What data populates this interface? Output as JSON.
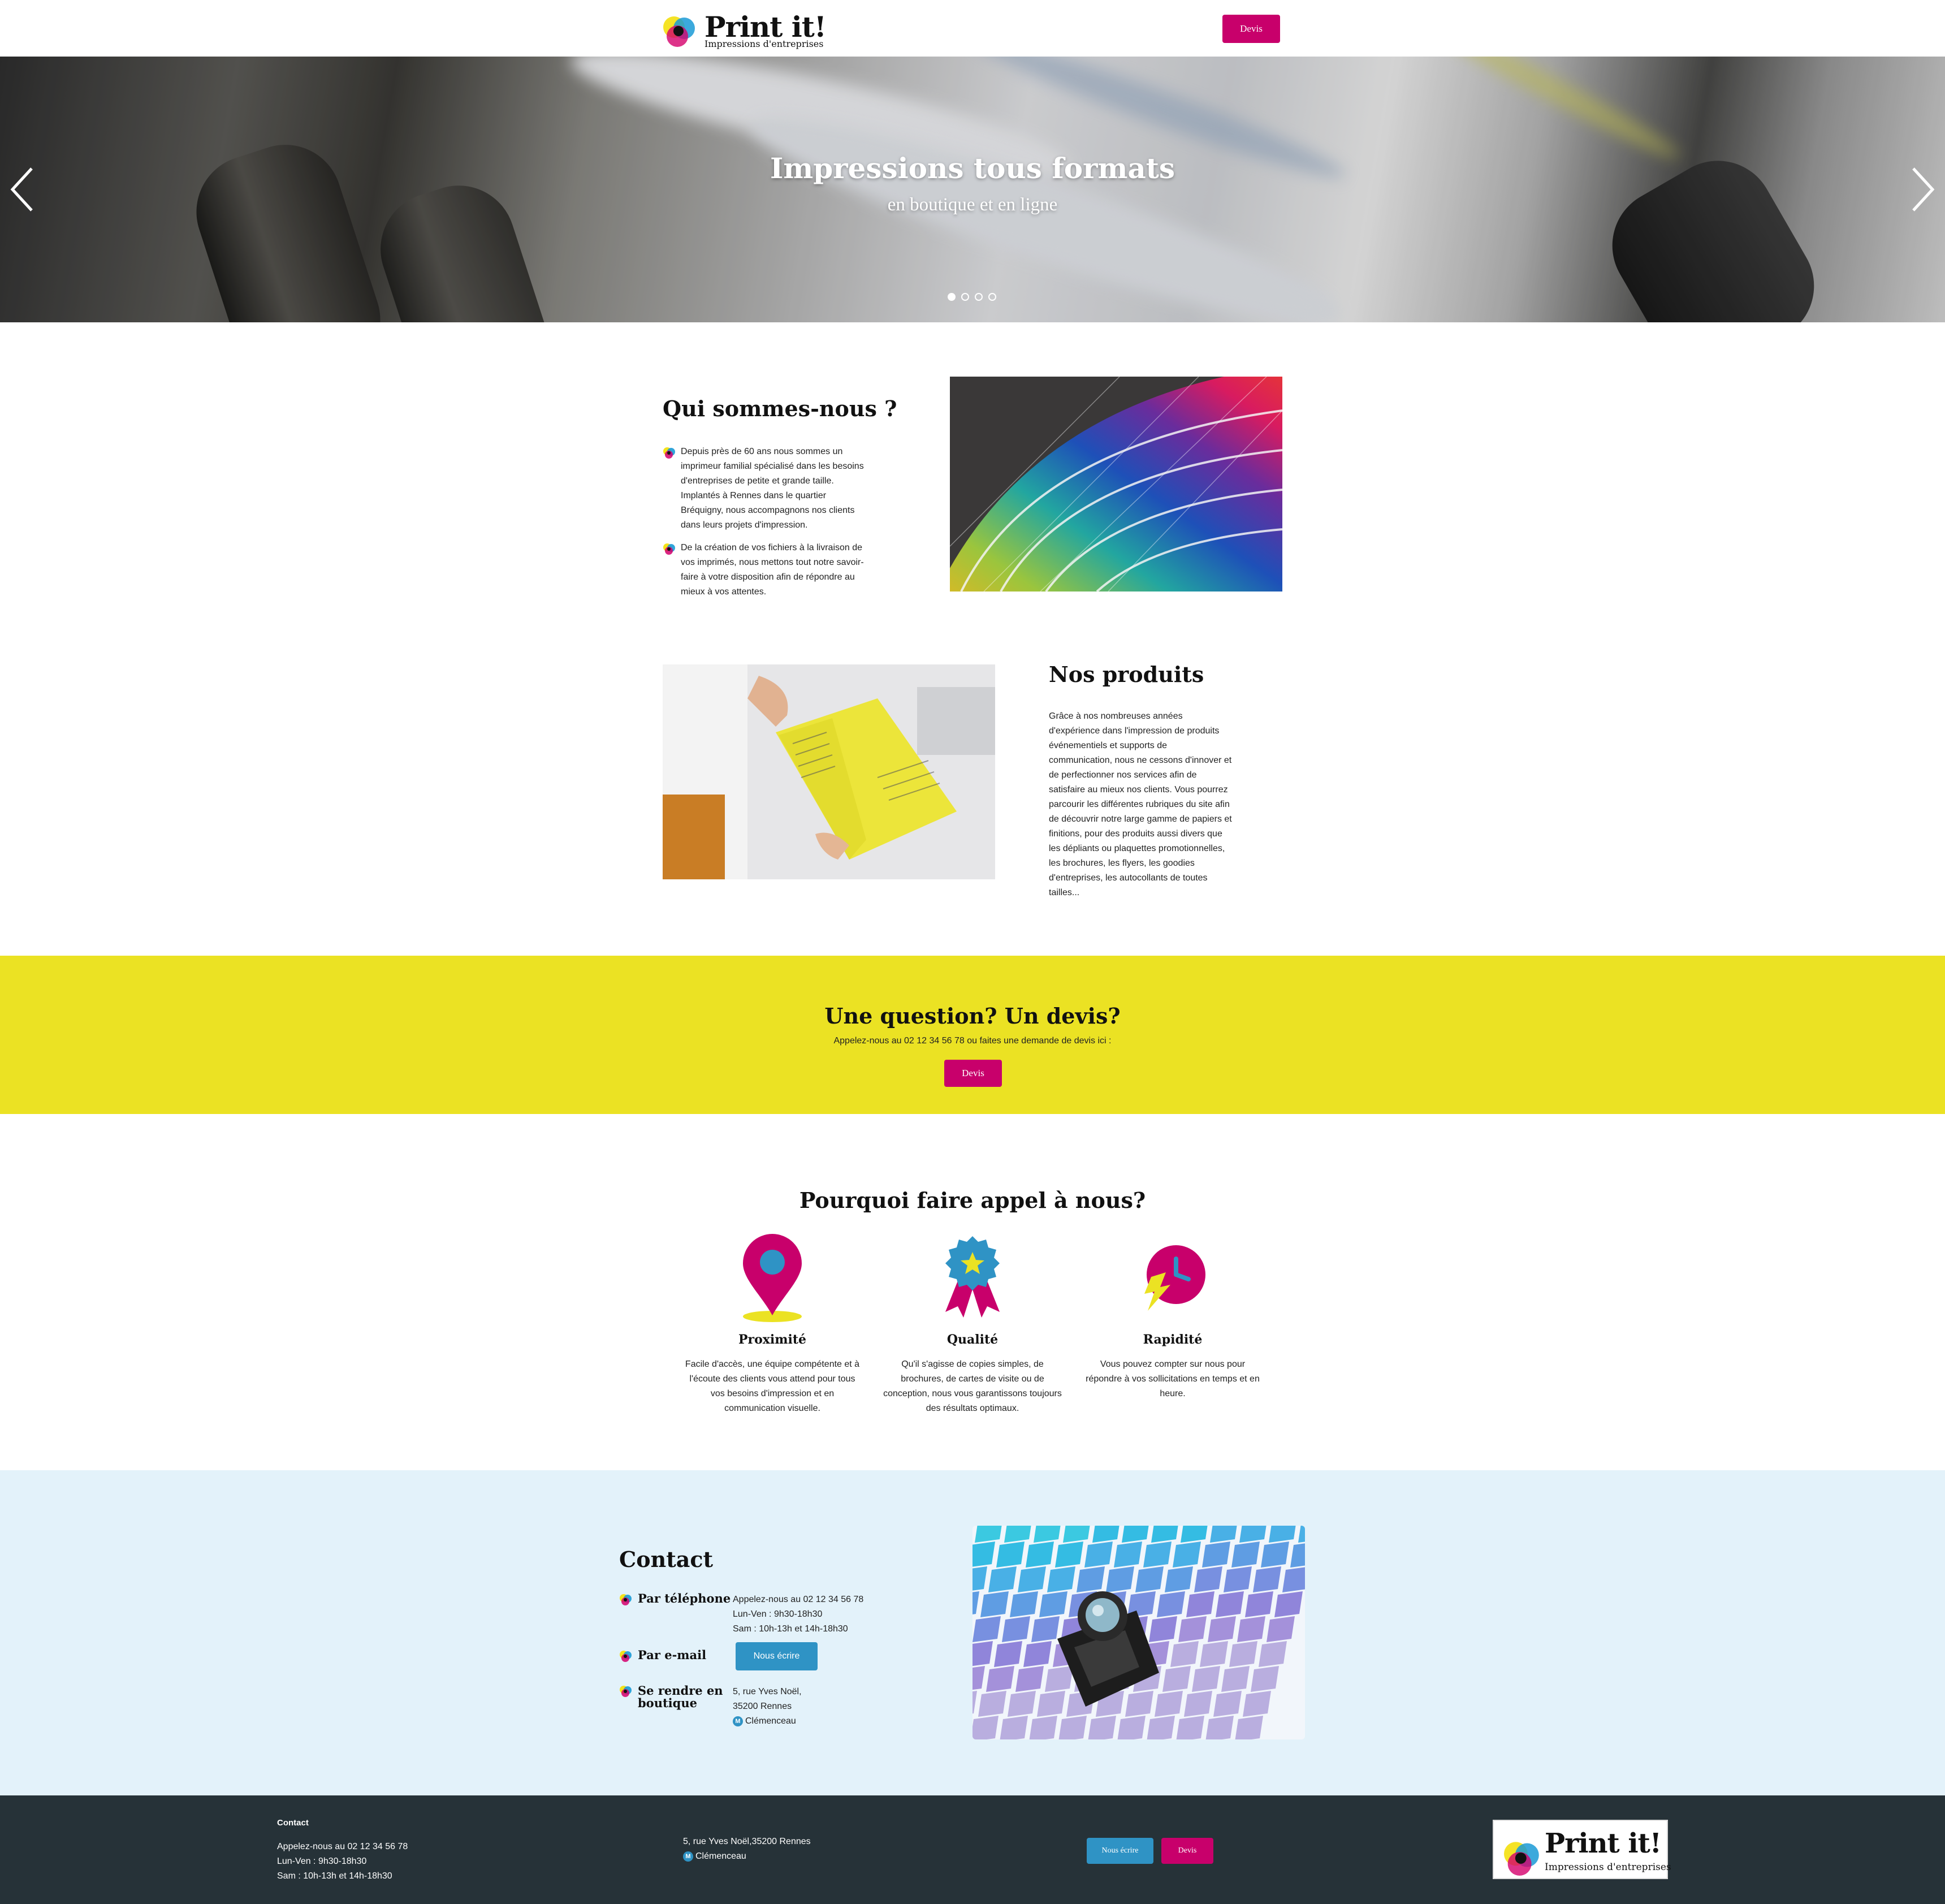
{
  "header": {
    "logo_title": "Print it!",
    "logo_subtitle": "Impressions d'entreprises",
    "quote_button": "Devis"
  },
  "hero": {
    "title": "Impressions tous formats",
    "subtitle": "en boutique et en ligne",
    "slides_count": 4,
    "active_slide": 1
  },
  "about": {
    "title": "Qui sommes-nous ?",
    "bullets": [
      "Depuis près de 60 ans nous sommes un imprimeur familial spécialisé dans les besoins d'entreprises de petite et grande taille. Implantés à Rennes dans le quartier Bréquigny, nous accompagnons nos clients dans leurs projets d'impression.",
      "De la création de vos fichiers à la livraison de vos imprimés, nous mettons tout notre savoir-faire à votre disposition afin de répondre au mieux à vos attentes."
    ]
  },
  "products": {
    "title": "Nos produits",
    "text": "Grâce à nos nombreuses années d'expérience dans l'impression de produits événementiels et supports de communication, nous ne cessons d'innover et de perfectionner nos services afin de satisfaire au mieux nos clients. Vous pourrez parcourir les différentes rubriques du site afin de découvrir notre large gamme de papiers et finitions, pour des produits aussi divers que les dépliants ou plaquettes promotionnelles, les brochures, les flyers, les goodies d'entreprises, les autocollants de toutes tailles..."
  },
  "cta": {
    "title": "Une question? Un devis?",
    "text": "Appelez-nous au 02 12 34 56 78 ou faites une demande de devis ici :",
    "button": "Devis"
  },
  "why": {
    "title": "Pourquoi faire appel à nous?",
    "features": [
      {
        "name": "Proximité",
        "icon": "location-pin-icon",
        "text": "Facile d'accès, une équipe compétente et à l'écoute des clients vous attend pour tous vos besoins d'impression et en communication visuelle."
      },
      {
        "name": "Qualité",
        "icon": "award-ribbon-icon",
        "text": "Qu'il s'agisse de copies simples, de brochures, de cartes de visite ou de conception, nous vous garantissons toujours des résultats optimaux."
      },
      {
        "name": "Rapidité",
        "icon": "fast-clock-icon",
        "text": "Vous pouvez compter sur nous pour répondre à vos sollicitations en temps et en heure."
      }
    ]
  },
  "contact": {
    "title": "Contact",
    "phone_label": "Par téléphone",
    "phone_lines": [
      "Appelez-nous au 02 12 34 56 78",
      "Lun-Ven : 9h30-18h30",
      "Sam : 10h-13h et 14h-18h30"
    ],
    "email_label": "Par e-mail",
    "email_button": "Nous écrire",
    "shop_label_1": "Se rendre en",
    "shop_label_2": "boutique",
    "address_lines": [
      "5, rue Yves Noël,",
      "35200 Rennes"
    ],
    "metro_letter": "M",
    "metro_station": "Clémenceau"
  },
  "footer": {
    "contact_title": "Contact",
    "lines": [
      "Appelez-nous au 02 12 34 56 78",
      "Lun-Ven : 9h30-18h30",
      "Sam : 10h-13h et 14h-18h30"
    ],
    "address": "5, rue Yves Noël,35200 Rennes",
    "metro_letter": "M",
    "metro_station": "Clémenceau",
    "write_button": "Nous écrire",
    "quote_button": "Devis",
    "logo_title": "Print it!",
    "logo_subtitle": "Impressions d'entreprises"
  },
  "colors": {
    "brand_pink": "#c8006b",
    "brand_blue": "#2f93c5",
    "brand_yellow": "#ebe223",
    "contact_bg": "#e3f2fa",
    "footer_bg": "#263238"
  }
}
